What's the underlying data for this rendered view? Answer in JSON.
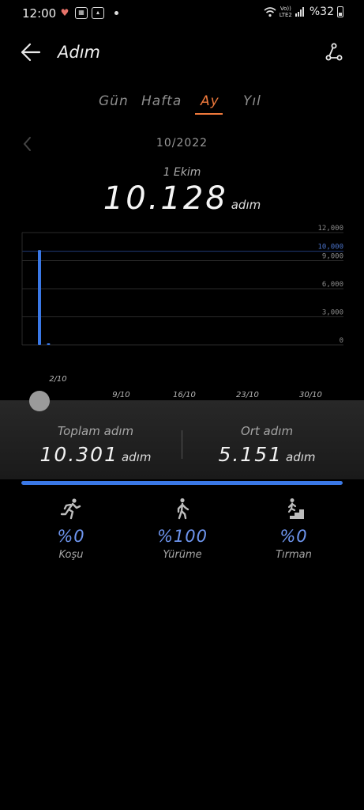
{
  "status_bar": {
    "time": "12:00",
    "left_icons": [
      "heart-icon",
      "badge-icon",
      "gallery-icon"
    ],
    "lte_label_top": "Vo))",
    "lte_label_bottom": "LTE2",
    "battery_text": "%32"
  },
  "app_bar": {
    "title": "Adım",
    "back_icon": "back-arrow-icon",
    "share_icon": "share-icon"
  },
  "tabs": [
    {
      "label": "Gün",
      "active": false
    },
    {
      "label": "Hafta",
      "active": false
    },
    {
      "label": "Ay",
      "active": true
    },
    {
      "label": "Yıl",
      "active": false
    }
  ],
  "period": {
    "label": "10/2022",
    "prev_icon": "chevron-left-icon"
  },
  "selected": {
    "date": "1 Ekim",
    "value": "10.128",
    "unit": "adım"
  },
  "chart_data": {
    "type": "bar",
    "categories": [
      "1/10",
      "2/10"
    ],
    "values": [
      10128,
      173
    ],
    "x_tick_labels": [
      "2/10",
      "9/10",
      "16/10",
      "23/10",
      "30/10"
    ],
    "y_tick_labels": [
      "12,000",
      "10,000",
      "9,000",
      "6,000",
      "3,000",
      "0"
    ],
    "y_ticks": [
      12000,
      10000,
      9000,
      6000,
      3000,
      0
    ],
    "goal_line": 10000,
    "ylim": [
      0,
      12000
    ],
    "xlim": [
      1,
      31
    ],
    "bar_color": "#3a78e6",
    "grid": true
  },
  "summary": {
    "total_label": "Toplam adım",
    "total_value": "10.301",
    "total_unit": "adım",
    "avg_label": "Ort adım",
    "avg_value": "5.151",
    "avg_unit": "adım",
    "progress_fraction": 1.0
  },
  "activities": [
    {
      "name": "running-icon",
      "pct": "%0",
      "label": "Koşu"
    },
    {
      "name": "walking-icon",
      "pct": "%100",
      "label": "Yürüme"
    },
    {
      "name": "stairs-climbing-icon",
      "pct": "%0",
      "label": "Tırman"
    }
  ],
  "colors": {
    "accent": "#f07a3c",
    "bar": "#3a78e6",
    "percent": "#6e95ee",
    "background": "#000000"
  }
}
